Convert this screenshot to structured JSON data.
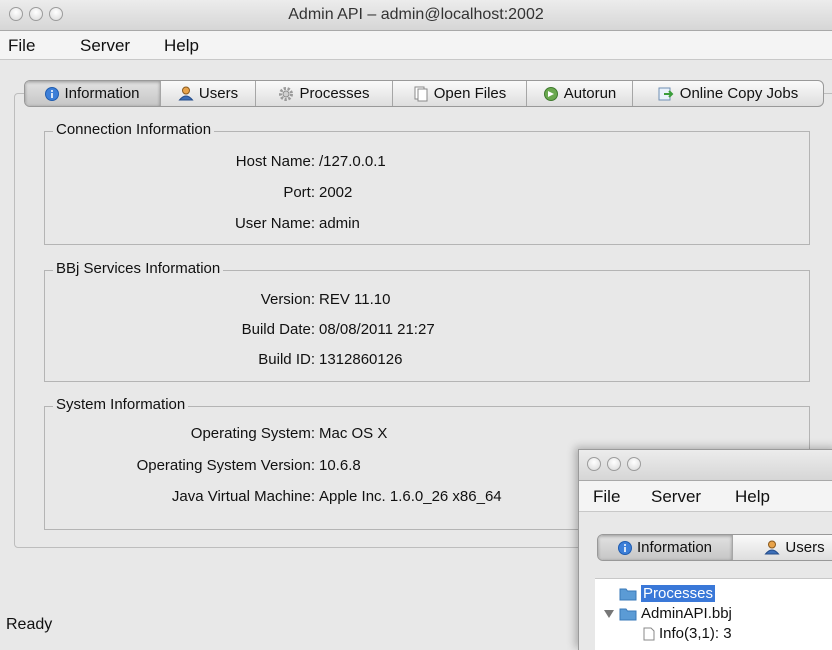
{
  "window": {
    "title": "Admin API – admin@localhost:2002"
  },
  "menu": [
    "File",
    "Server",
    "Help"
  ],
  "tabs": [
    {
      "label": "Information",
      "icon": "info-icon",
      "active": true
    },
    {
      "label": "Users",
      "icon": "users-icon",
      "active": false
    },
    {
      "label": "Processes",
      "icon": "gear-icon",
      "active": false
    },
    {
      "label": "Open Files",
      "icon": "files-icon",
      "active": false
    },
    {
      "label": "Autorun",
      "icon": "autorun-icon",
      "active": false
    },
    {
      "label": "Online Copy Jobs",
      "icon": "copy-jobs-icon",
      "active": false
    }
  ],
  "connection": {
    "title": "Connection Information",
    "rows": [
      {
        "label": "Host Name:",
        "value": "/127.0.0.1"
      },
      {
        "label": "Port:",
        "value": "2002"
      },
      {
        "label": "User Name:",
        "value": "admin"
      }
    ]
  },
  "services": {
    "title": "BBj Services Information",
    "rows": [
      {
        "label": "Version:",
        "value": "REV 11.10"
      },
      {
        "label": "Build Date:",
        "value": "08/08/2011 21:27"
      },
      {
        "label": "Build ID:",
        "value": "1312860126"
      }
    ]
  },
  "system": {
    "title": "System Information",
    "rows": [
      {
        "label": "Operating System:",
        "value": "Mac OS X"
      },
      {
        "label": "Operating System Version:",
        "value": "10.6.8"
      },
      {
        "label": "Java Virtual Machine:",
        "value": "Apple Inc. 1.6.0_26 x86_64"
      }
    ]
  },
  "status": {
    "text": "Ready"
  },
  "second_window": {
    "menu": [
      "File",
      "Server",
      "Help"
    ],
    "tabs": [
      {
        "label": "Information",
        "icon": "info-icon",
        "active": true
      },
      {
        "label": "Users",
        "icon": "users-icon",
        "active": false
      }
    ],
    "tree": [
      {
        "label": "Processes",
        "selected": true
      },
      {
        "label": "AdminAPI.bbj",
        "selected": false
      },
      {
        "label": "Info(3,1): 3",
        "selected": false
      }
    ]
  },
  "colors": {
    "selection": "#3a78d8",
    "window_bg": "#e8e8e8"
  }
}
